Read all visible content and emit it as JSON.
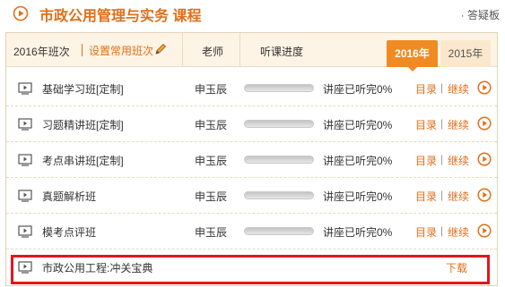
{
  "header": {
    "course_title": "市政公用管理与实务  课程",
    "qa_link": "· 答疑板"
  },
  "table_header": {
    "session_label": "2016年班次",
    "set_common_label": "设置常用班次",
    "teacher_col": "老师",
    "progress_col": "听课进度"
  },
  "year_tabs": [
    {
      "label": "2016年",
      "active": true
    },
    {
      "label": "2015年",
      "active": false
    }
  ],
  "courses": [
    {
      "name": "基础学习班[定制]",
      "teacher": "申玉辰",
      "progress": 0,
      "status": "讲座已听完0%",
      "catalog": "目录",
      "continue": "继续"
    },
    {
      "name": "习题精讲班[定制]",
      "teacher": "申玉辰",
      "progress": 0,
      "status": "讲座已听完0%",
      "catalog": "目录",
      "continue": "继续"
    },
    {
      "name": "考点串讲班[定制]",
      "teacher": "申玉辰",
      "progress": 0,
      "status": "讲座已听完0%",
      "catalog": "目录",
      "continue": "继续"
    },
    {
      "name": "真题解析班",
      "teacher": "申玉辰",
      "progress": 0,
      "status": "讲座已听完0%",
      "catalog": "目录",
      "continue": "继续"
    },
    {
      "name": "模考点评班",
      "teacher": "申玉辰",
      "progress": 0,
      "status": "讲座已听完0%",
      "catalog": "目录",
      "continue": "继续"
    }
  ],
  "resource": {
    "name": "市政公用工程:冲关宝典",
    "download": "下载"
  },
  "colors": {
    "accent": "#e06f1a",
    "tab_active": "#f08a22",
    "highlight": "#e8141a"
  },
  "icons": [
    "play-circle-icon",
    "pencil-icon",
    "video-icon",
    "play-button-icon"
  ]
}
